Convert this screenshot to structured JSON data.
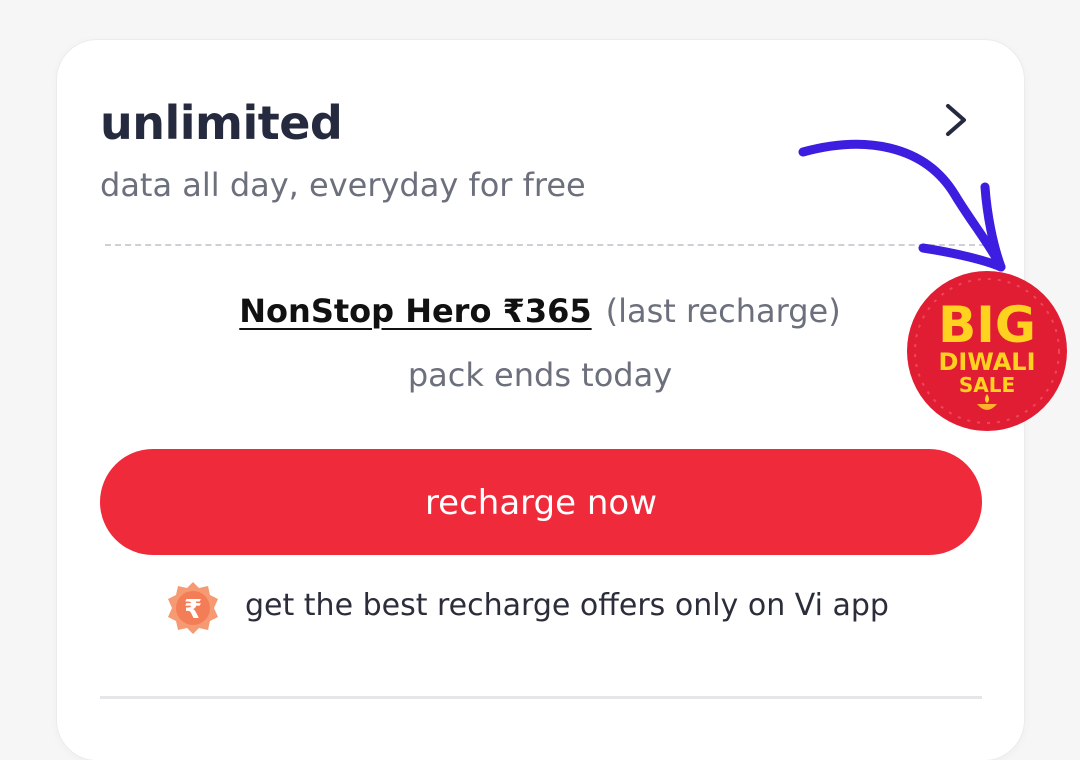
{
  "plan": {
    "title": "unlimited",
    "subtitle": "data all day, everyday for free"
  },
  "last_pack": {
    "name": "NonStop Hero ₹365",
    "note": "(last recharge)",
    "expiry": "pack ends today"
  },
  "actions": {
    "recharge_label": "recharge now"
  },
  "offer": {
    "text": "get the best recharge offers only on Vi app",
    "icon": "rupee-badge-icon"
  },
  "promo_badge": {
    "line1": "BIG",
    "line2": "DIWALI",
    "line3": "SALE",
    "icon": "diya-icon"
  },
  "colors": {
    "primary_red": "#ee2a3b",
    "title_text": "#262a3e",
    "muted_text": "#6c6f7c",
    "annotation_arrow": "#3d1ddf",
    "badge_yellow": "#ffd21f"
  }
}
